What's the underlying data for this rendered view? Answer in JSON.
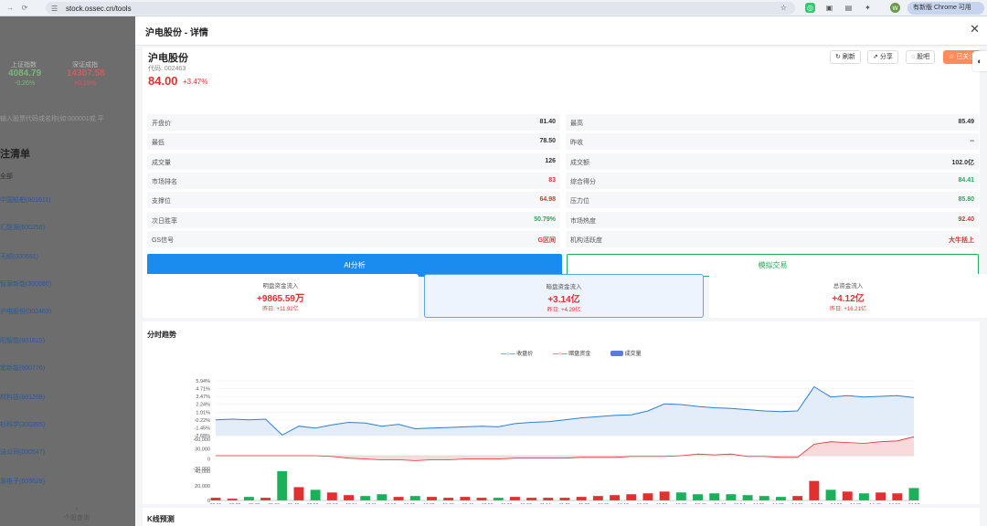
{
  "browser": {
    "url": "stock.ossec.cn/tools",
    "update_label": "有新版 Chrome 可用",
    "nav_icons": [
      "arrow-right-icon",
      "reload-icon"
    ]
  },
  "background": {
    "indices": [
      {
        "name": "上证指数",
        "value": "4084.79",
        "change": "-0.26%"
      },
      {
        "name": "深证成指",
        "value": "14307.58",
        "change": "+0.19%"
      }
    ],
    "search_placeholder": "输入股票代码或名称(如:000001或 平",
    "list_title": "注清单",
    "list_sub": "全部",
    "items": [
      "中国船舶(601611)",
      "汇能源(600256)",
      "天顺(000691)",
      "智源新能(300080)",
      "沪电股份(002463)",
      "阳智能(601615)",
      "宏新能(600776)",
      "材料技(601208)",
      "杉科学(300395)",
      "洁公司(000547)",
      "源电子(603629)"
    ],
    "query_label": "个股查询"
  },
  "modal": {
    "title": "沪电股份 - 详情",
    "stock_name": "沪电股份",
    "code_label": "代码: 002463",
    "price": "84.00",
    "change_pct": "+3.47%",
    "actions": {
      "refresh": "刷新",
      "share": "分享",
      "forum": "股吧",
      "followed": "已关注"
    },
    "left_rows": [
      {
        "label": "开盘价",
        "value": "81.40",
        "color": "dark"
      },
      {
        "label": "最低",
        "value": "78.50",
        "color": "dark"
      },
      {
        "label": "成交量",
        "value": "126",
        "color": "dark"
      },
      {
        "label": "市场排名",
        "value": "83",
        "color": "red"
      },
      {
        "label": "支撑位",
        "value": "64.98",
        "color": "red"
      },
      {
        "label": "次日胜率",
        "value": "50.79%",
        "color": "green"
      },
      {
        "label": "GS信号",
        "value": "G区间",
        "color": "red"
      }
    ],
    "right_rows": [
      {
        "label": "最高",
        "value": "85.49",
        "color": "dark"
      },
      {
        "label": "昨收",
        "value": "--",
        "color": "dark"
      },
      {
        "label": "成交额",
        "value": "102.0亿",
        "color": "dark"
      },
      {
        "label": "综合得分",
        "value": "84.41",
        "color": "green"
      },
      {
        "label": "压力位",
        "value": "85.80",
        "color": "green"
      },
      {
        "label": "市场热度",
        "value": "92.40",
        "color": "red"
      },
      {
        "label": "机构活跃度",
        "value": "大牛括上",
        "color": "red"
      }
    ],
    "ai_button": "AI分析",
    "sim_button": "模拟交易",
    "flows": [
      {
        "title": "明盘资金流入",
        "value": "+9865.59万",
        "yesterday": "昨日: +11.92亿"
      },
      {
        "title": "暗盘资金流入",
        "value": "+3.14亿",
        "yesterday": "昨日: +4.29亿"
      },
      {
        "title": "总资金流入",
        "value": "+4.12亿",
        "yesterday": "昨日: +16.21亿"
      }
    ],
    "chart_title": "分时趋势",
    "kline_title": "K线预测"
  },
  "chart_data": {
    "type": "line",
    "legend": [
      "收盘价",
      "暗盘资金",
      "成交量"
    ],
    "colors": {
      "price": "#2f7fd8",
      "dark_flow": "#e03131",
      "volume_up": "#e03131",
      "volume_down": "#1cb05a"
    },
    "price_ticks": [
      "5.94%",
      "4.71%",
      "3.47%",
      "2.24%",
      "1.01%",
      "-0.22%",
      "-1.45%",
      "-2.68%"
    ],
    "flow_ticks": [
      "-60,000",
      "30,000",
      "0",
      "-30,000"
    ],
    "volume_ticks": [
      "40,000",
      "20,000",
      "0"
    ],
    "time_labels": [
      "09:15",
      "09:22",
      "09:29",
      "09:36",
      "09:43",
      "09:50",
      "09:57",
      "10:04",
      "10:11",
      "10:18",
      "10:25",
      "10:32",
      "10:39",
      "10:46",
      "10:53",
      "11:00",
      "11:07",
      "11:14",
      "11:21",
      "11:28",
      "13:05",
      "13:12",
      "13:19",
      "13:26",
      "13:33",
      "13:40",
      "13:47",
      "13:54",
      "14:01",
      "14:08",
      "14:15",
      "14:22",
      "14:29",
      "14:36",
      "14:43",
      "14:50",
      "14:57"
    ],
    "price_pct": [
      -0.2,
      -0.1,
      -0.2,
      -0.1,
      -2.6,
      -1.2,
      -1.5,
      -1.0,
      -0.6,
      -0.7,
      -1.2,
      -0.9,
      -1.6,
      -1.5,
      -1.4,
      -1.3,
      -1.2,
      -1.3,
      -0.8,
      -0.6,
      -0.5,
      -0.2,
      0.1,
      0.3,
      0.5,
      0.6,
      1.2,
      2.3,
      2.2,
      1.9,
      1.7,
      1.6,
      1.4,
      1.2,
      1.1,
      1.2,
      5.0,
      3.4,
      3.6,
      3.4,
      3.5,
      3.6,
      3.3
    ],
    "dark_flow": [
      0,
      0,
      0,
      0,
      0,
      0,
      0,
      -1,
      -3,
      -4,
      -5,
      -5,
      -6,
      -5,
      -5,
      -4,
      -4,
      -4,
      -3,
      -3,
      -3,
      -3,
      -2,
      -2,
      -2,
      -1,
      -1,
      -1,
      0,
      2,
      1,
      2,
      -1,
      -1,
      -2,
      -2,
      14,
      17,
      16,
      15,
      17,
      18,
      23
    ],
    "volume": [
      3,
      2,
      4,
      3,
      33,
      15,
      12,
      9,
      6,
      5,
      7,
      4,
      5,
      4,
      3,
      4,
      3,
      3,
      4,
      3,
      3,
      3,
      4,
      5,
      6,
      7,
      8,
      10,
      9,
      7,
      8,
      7,
      6,
      5,
      4,
      5,
      22,
      12,
      10,
      8,
      9,
      8,
      14
    ],
    "ylim_pct": [
      -2.68,
      5.94
    ]
  }
}
